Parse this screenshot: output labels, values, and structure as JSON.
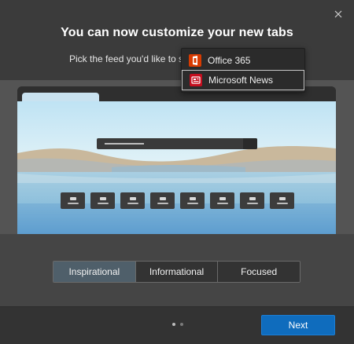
{
  "dialog": {
    "title": "You can now customize your new tabs",
    "subtitle": "Pick the feed you'd like to see"
  },
  "feed_dropdown": {
    "items": [
      {
        "label": "Office 365",
        "icon": "office-365-icon",
        "color": "#d83b01"
      },
      {
        "label": "Microsoft News",
        "icon": "microsoft-news-icon",
        "color": "#c50f1f",
        "selected": true
      }
    ]
  },
  "layout_options": {
    "items": [
      {
        "label": "Inspirational",
        "selected": true
      },
      {
        "label": "Informational"
      },
      {
        "label": "Focused"
      }
    ]
  },
  "pager": {
    "total": 2,
    "current": 1
  },
  "footer": {
    "next_label": "Next"
  },
  "colors": {
    "accent": "#0f6cbd",
    "segment_active": "#4f5f6a"
  }
}
